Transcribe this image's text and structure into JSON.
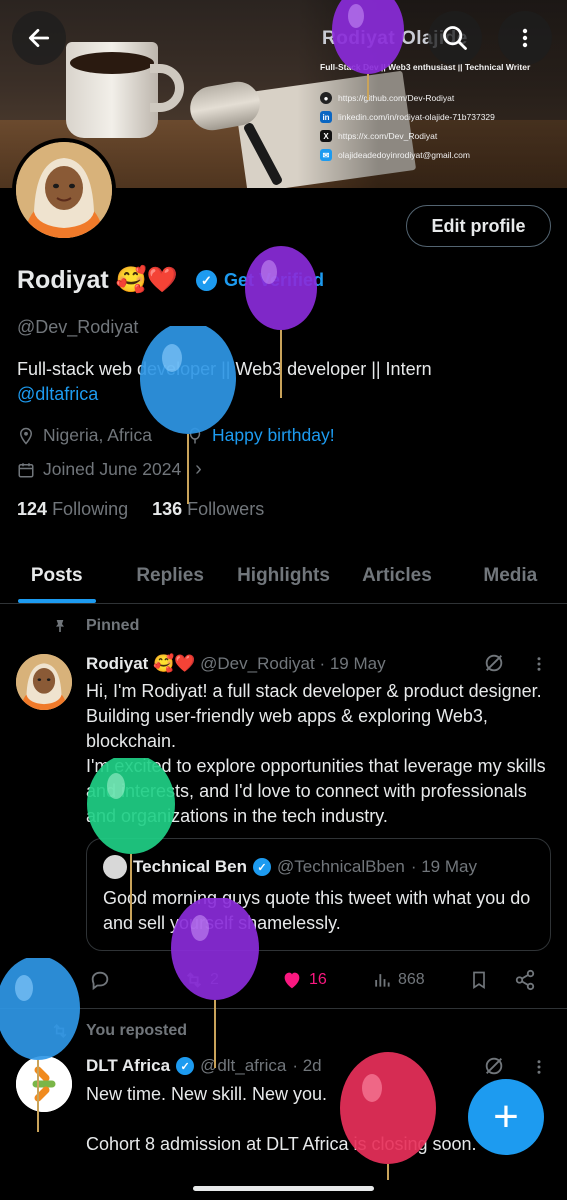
{
  "banner": {
    "name": "Rodiyat Olajide",
    "tagline": "Full-Stack Dev || Web3 enthusiast || Technical Writer",
    "links": [
      {
        "icon": "github-icon",
        "text": "https://github.com/Dev-Rodiyat"
      },
      {
        "icon": "linkedin-icon",
        "text": "linkedin.com/in/rodiyat-olajide-71b737329"
      },
      {
        "icon": "x-icon",
        "text": "https://x.com/Dev_Rodiyat"
      },
      {
        "icon": "mail-icon",
        "text": "olajideadedoyinrodiyat@gmail.com"
      }
    ]
  },
  "profile": {
    "name": "Rodiyat 🥰❤️",
    "get_verified": "Get Verified",
    "handle": "@Dev_Rodiyat",
    "bio": "Full-stack web developer || Web3 developer || Intern",
    "bio_mention": "@dltafrica",
    "location": "Nigeria, Africa",
    "birthday": "Happy birthday!",
    "joined": "Joined June 2024",
    "following_count": "124",
    "following_label": "Following",
    "followers_count": "136",
    "followers_label": "Followers",
    "edit_label": "Edit profile"
  },
  "tabs": [
    "Posts",
    "Replies",
    "Highlights",
    "Articles",
    "Media"
  ],
  "pinned_label": "Pinned",
  "post1": {
    "name": "Rodiyat 🥰❤️",
    "handle": "@Dev_Rodiyat",
    "date": "· 19 May",
    "text1": "Hi, I'm Rodiyat! a full stack developer & product designer. Building user-friendly web apps & exploring Web3, blockchain.",
    "text2": "I'm excited to explore opportunities that leverage my skills and interests, and I'd love to connect with professionals and organizations in the tech industry.",
    "quote": {
      "name": "Technical Ben",
      "handle": "@TechnicalBben",
      "date": "· 19 May",
      "text": "Good morning guys quote this tweet with what you do and sell yourself shamelessly."
    },
    "reposts": "2",
    "likes": "16",
    "views": "868"
  },
  "reposted_label": "You reposted",
  "post2": {
    "name": "DLT Africa",
    "handle": "@dlt_africa",
    "date": "· 2d",
    "text1": "New time. New skill. New you.",
    "text2": "Cohort 8 admission at DLT Africa is closing soon."
  },
  "colors": {
    "accent": "#1d9bf0",
    "like": "#f91880",
    "muted": "#71767b"
  }
}
